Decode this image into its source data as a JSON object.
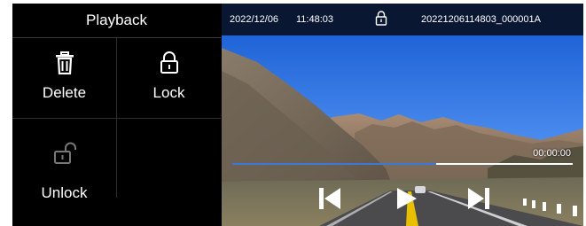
{
  "menu": {
    "title": "Playback",
    "items": [
      {
        "label": "Delete",
        "icon": "trash-icon"
      },
      {
        "label": "Lock",
        "icon": "lock-icon"
      },
      {
        "label": "Unlock",
        "icon": "unlock-icon"
      }
    ]
  },
  "video": {
    "date": "2022/12/06",
    "time": "11:48:03",
    "filename": "20221206114803_000001A",
    "lock_icon": "lock-icon",
    "elapsed": "00:00:00",
    "progress": 0.6
  },
  "controls": {
    "previous_icon": "previous-icon",
    "play_icon": "play-icon",
    "next_icon": "next-icon"
  },
  "colors": {
    "panel_background": "#000000",
    "topbar_background": "#0a1733",
    "progress_fill": "#3b78d8",
    "progress_track": "#ffffff"
  }
}
